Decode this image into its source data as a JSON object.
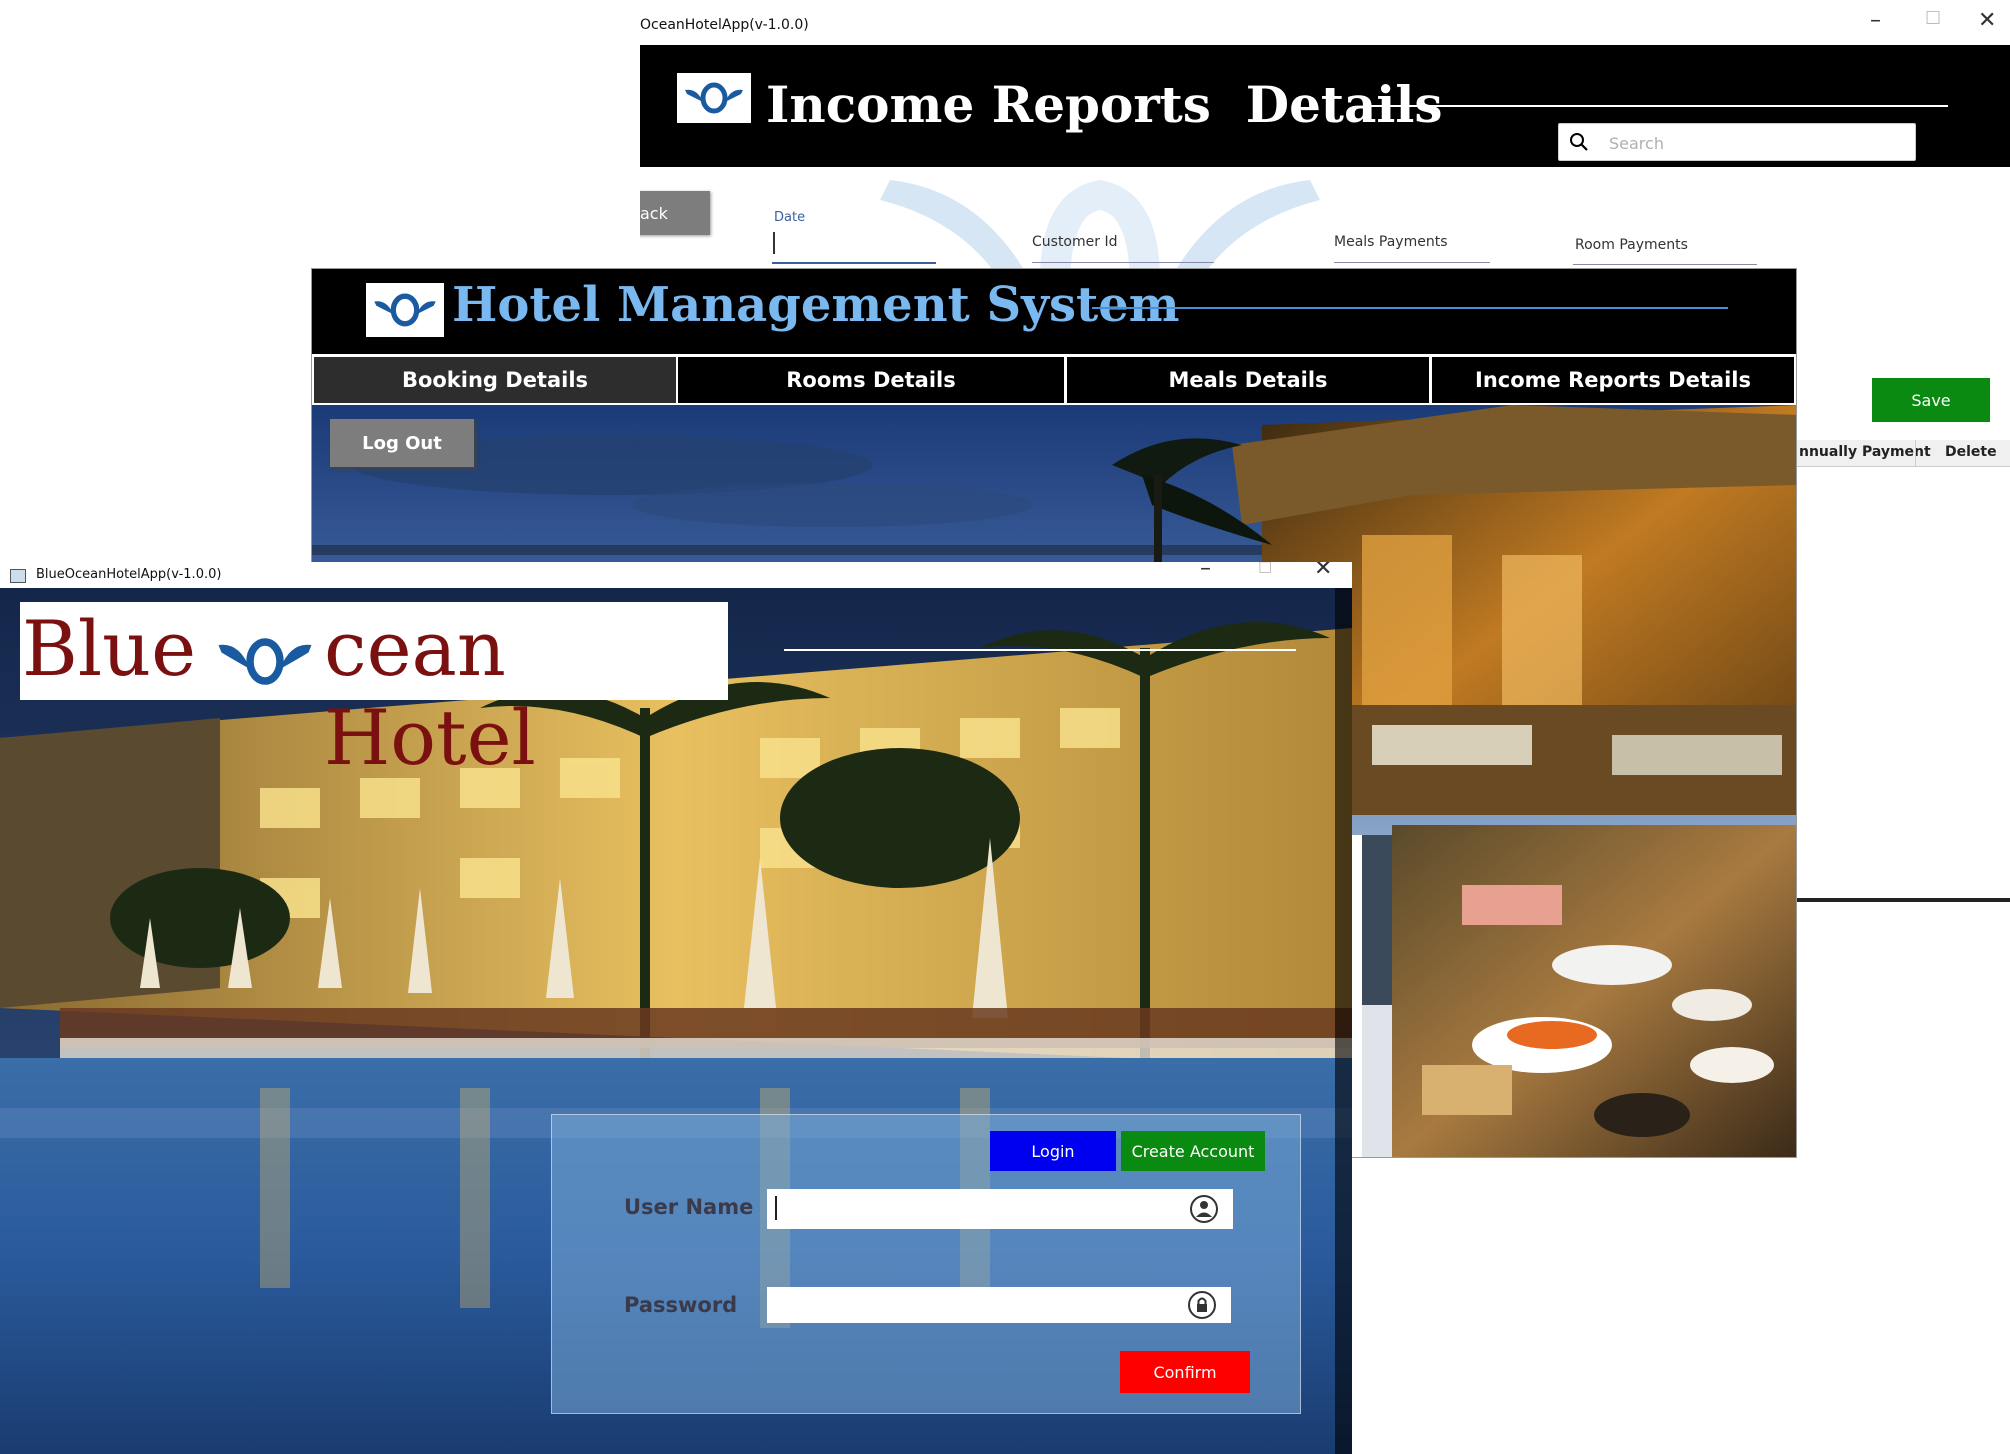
{
  "income_window": {
    "title": "OceanHotelApp(v-1.0.0)",
    "header_title": "Income Reports  Details",
    "search": {
      "placeholder": "Search",
      "value": ""
    },
    "back_label": "ack",
    "fields": {
      "date_label": "Date",
      "customer_id_label": "Customer Id",
      "meals_payments_label": "Meals Payments",
      "room_payments_label": "Room Payments"
    },
    "save_label": "Save",
    "table_columns": [
      "nnually Payment",
      "Delete"
    ],
    "colors": {
      "save": "#0a8a10",
      "header_bg": "#000000"
    }
  },
  "hms_window": {
    "header_title": "Hotel Management System",
    "tabs": [
      {
        "label": "Booking Details",
        "active": true
      },
      {
        "label": "Rooms Details",
        "active": false
      },
      {
        "label": "Meals Details",
        "active": false
      },
      {
        "label": "Income Reports Details",
        "active": false
      }
    ],
    "logout_label": "Log Out",
    "colors": {
      "title": "#7ab8f0"
    }
  },
  "login_window": {
    "title": "BlueOceanHotelApp(v-1.0.0)",
    "brand_blue": "Blue",
    "brand_rest": "cean Hotel",
    "login_label": "Login",
    "create_account_label": "Create Account",
    "username_label": "User Name",
    "password_label": "Password",
    "username_value": "",
    "password_value": "",
    "confirm_label": "Confirm",
    "icons": {
      "user": "user-circle-icon",
      "lock": "lock-circle-icon"
    },
    "colors": {
      "login": "#0000f0",
      "create_account": "#0a8a10",
      "confirm": "#ff0000",
      "brand": "#7a1010"
    }
  }
}
